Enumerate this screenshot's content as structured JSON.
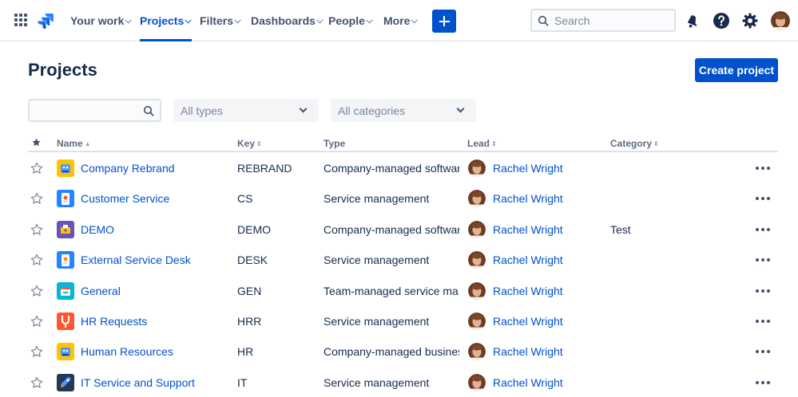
{
  "nav": {
    "items": [
      {
        "label": "Your work",
        "active": false
      },
      {
        "label": "Projects",
        "active": true
      },
      {
        "label": "Filters",
        "active": false
      },
      {
        "label": "Dashboards",
        "active": false
      },
      {
        "label": "People",
        "active": false
      },
      {
        "label": "More",
        "active": false
      }
    ],
    "search_placeholder": "Search"
  },
  "page": {
    "title": "Projects",
    "create_label": "Create project"
  },
  "filters": {
    "search_value": "",
    "type_value": "All types",
    "category_value": "All categories"
  },
  "table": {
    "headers": {
      "name": "Name",
      "key": "Key",
      "type": "Type",
      "lead": "Lead",
      "category": "Category"
    },
    "rows": [
      {
        "name": "Company Rebrand",
        "key": "REBRAND",
        "type": "Company-managed software",
        "lead": "Rachel Wright",
        "category": "",
        "icon": "rebrand-project-icon",
        "starred": false
      },
      {
        "name": "Customer Service",
        "key": "CS",
        "type": "Service management",
        "lead": "Rachel Wright",
        "category": "",
        "icon": "customer-service-project-icon",
        "starred": false
      },
      {
        "name": "DEMO",
        "key": "DEMO",
        "type": "Company-managed software",
        "lead": "Rachel Wright",
        "category": "Test",
        "icon": "demo-project-icon",
        "starred": false
      },
      {
        "name": "External Service Desk",
        "key": "DESK",
        "type": "Service management",
        "lead": "Rachel Wright",
        "category": "",
        "icon": "service-desk-project-icon",
        "starred": false
      },
      {
        "name": "General",
        "key": "GEN",
        "type": "Team-managed service ma...",
        "lead": "Rachel Wright",
        "category": "",
        "icon": "general-project-icon",
        "starred": false
      },
      {
        "name": "HR Requests",
        "key": "HRR",
        "type": "Service management",
        "lead": "Rachel Wright",
        "category": "",
        "icon": "hr-requests-project-icon",
        "starred": false
      },
      {
        "name": "Human Resources",
        "key": "HR",
        "type": "Company-managed business",
        "lead": "Rachel Wright",
        "category": "",
        "icon": "human-resources-project-icon",
        "starred": false
      },
      {
        "name": "IT Service and Support",
        "key": "IT",
        "type": "Service management",
        "lead": "Rachel Wright",
        "category": "",
        "icon": "it-support-project-icon",
        "starred": false
      }
    ]
  },
  "colors": {
    "brand": "#0052cc",
    "text": "#172b4d",
    "subtle": "#5e6c84"
  }
}
